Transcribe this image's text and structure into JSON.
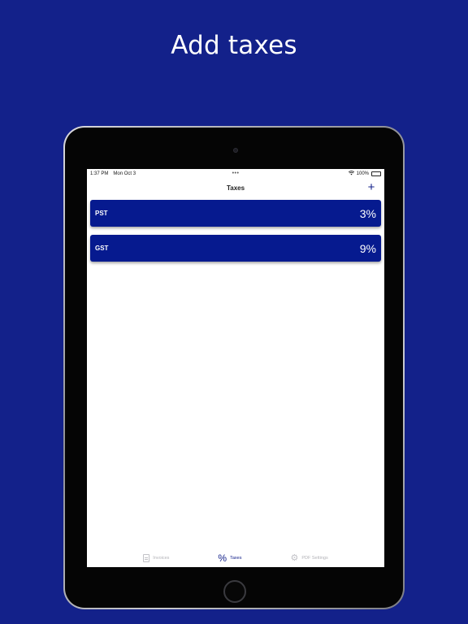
{
  "headline": "Add taxes",
  "status_bar": {
    "time": "1:37 PM",
    "date": "Mon Oct 3",
    "dots": "•••",
    "battery": "100%"
  },
  "nav": {
    "title": "Taxes",
    "add_icon": "plus-icon",
    "add_symbol": "+"
  },
  "taxes": [
    {
      "name": "PST",
      "rate": "3%"
    },
    {
      "name": "GST",
      "rate": "9%"
    }
  ],
  "tabs": [
    {
      "label": "Invoices",
      "icon": "document-icon",
      "active": false
    },
    {
      "label": "Taxes",
      "icon": "percent-icon",
      "symbol": "%",
      "active": true
    },
    {
      "label": "PDF Settings",
      "icon": "gear-icon",
      "symbol": "⚙",
      "active": false
    }
  ],
  "colors": {
    "background": "#13218a",
    "accent": "#061a8f"
  }
}
